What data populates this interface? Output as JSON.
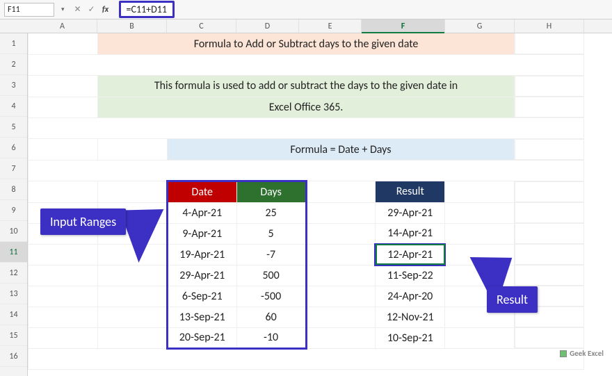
{
  "namebox": {
    "value": "F11"
  },
  "formula_bar": {
    "fx_label": "fx",
    "value": "=C11+D11"
  },
  "columns": [
    "A",
    "B",
    "C",
    "D",
    "E",
    "F",
    "G",
    "H"
  ],
  "rows": [
    "1",
    "2",
    "3",
    "4",
    "5",
    "6",
    "7",
    "8",
    "9",
    "10",
    "11",
    "12",
    "13",
    "14",
    "15",
    "16"
  ],
  "selected": {
    "col": "F",
    "row": "11"
  },
  "title": "Formula to Add or Subtract days to the given date",
  "description_line1": "This formula is used to add or subtract the days to the given date in",
  "description_line2": "Excel Office 365.",
  "formula_row_text": "Formula = Date + Days",
  "headers": {
    "date": "Date",
    "days": "Days",
    "result": "Result"
  },
  "data": [
    {
      "date": "4-Apr-21",
      "days": "25",
      "result": "29-Apr-21"
    },
    {
      "date": "9-Apr-21",
      "days": "5",
      "result": "14-Apr-21"
    },
    {
      "date": "19-Apr-21",
      "days": "-7",
      "result": "12-Apr-21"
    },
    {
      "date": "29-Apr-21",
      "days": "500",
      "result": "11-Sep-22"
    },
    {
      "date": "6-Sep-21",
      "days": "-500",
      "result": "24-Apr-20"
    },
    {
      "date": "13-Sep-21",
      "days": "60",
      "result": "12-Nov-21"
    },
    {
      "date": "20-Sep-21",
      "days": "-10",
      "result": "10-Sep-21"
    }
  ],
  "callouts": {
    "input": "Input Ranges",
    "result": "Result"
  },
  "watermark": "Geek Excel",
  "icons": {
    "dropdown": "▾",
    "cancel": "✕",
    "confirm": "✓"
  },
  "chart_data": {
    "type": "table",
    "title": "Formula to Add or Subtract days to the given date",
    "columns": [
      "Date",
      "Days",
      "Result"
    ],
    "rows": [
      [
        "4-Apr-21",
        25,
        "29-Apr-21"
      ],
      [
        "9-Apr-21",
        5,
        "14-Apr-21"
      ],
      [
        "19-Apr-21",
        -7,
        "12-Apr-21"
      ],
      [
        "29-Apr-21",
        500,
        "11-Sep-22"
      ],
      [
        "6-Sep-21",
        -500,
        "24-Apr-20"
      ],
      [
        "13-Sep-21",
        60,
        "12-Nov-21"
      ],
      [
        "20-Sep-21",
        -10,
        "10-Sep-21"
      ]
    ],
    "formula": "=C11+D11"
  }
}
